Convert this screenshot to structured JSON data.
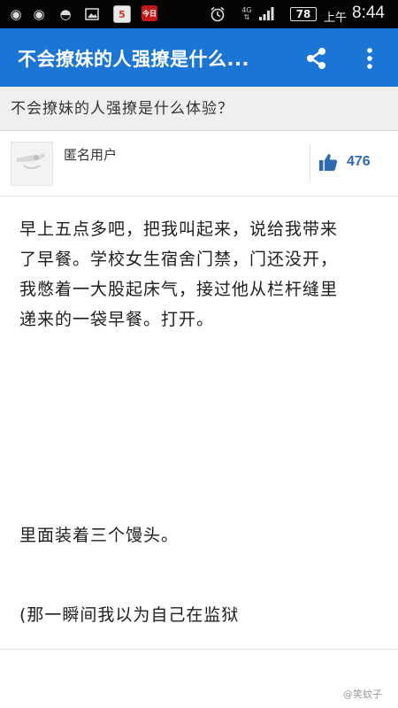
{
  "status_bar": {
    "network": "4G",
    "battery": "78",
    "ampm": "上午",
    "time": "8:44",
    "app_badge_5": "5",
    "news_badge": "今日"
  },
  "app_bar": {
    "title": "不会撩妹的人强撩是什么...",
    "share_icon": "share-icon",
    "more_icon": "more-vert-icon",
    "color": "#1a75d4"
  },
  "question": {
    "title": "不会撩妹的人强撩是什么体验？"
  },
  "author": {
    "name": "匿名用户",
    "upvotes": "476"
  },
  "answer": {
    "paragraph_1": "早上五点多吧，把我叫起来，说给我带来\n了早餐。学校女生宿舍门禁，门还没开，\n我憋着一大股起床气，接过他从栏杆缝里\n递来的一袋早餐。打开。",
    "paragraph_2": "里面装着三个馒头。",
    "paragraph_3": "(那一瞬间我以为自己在监狱"
  },
  "watermark": "@笑蚊子"
}
